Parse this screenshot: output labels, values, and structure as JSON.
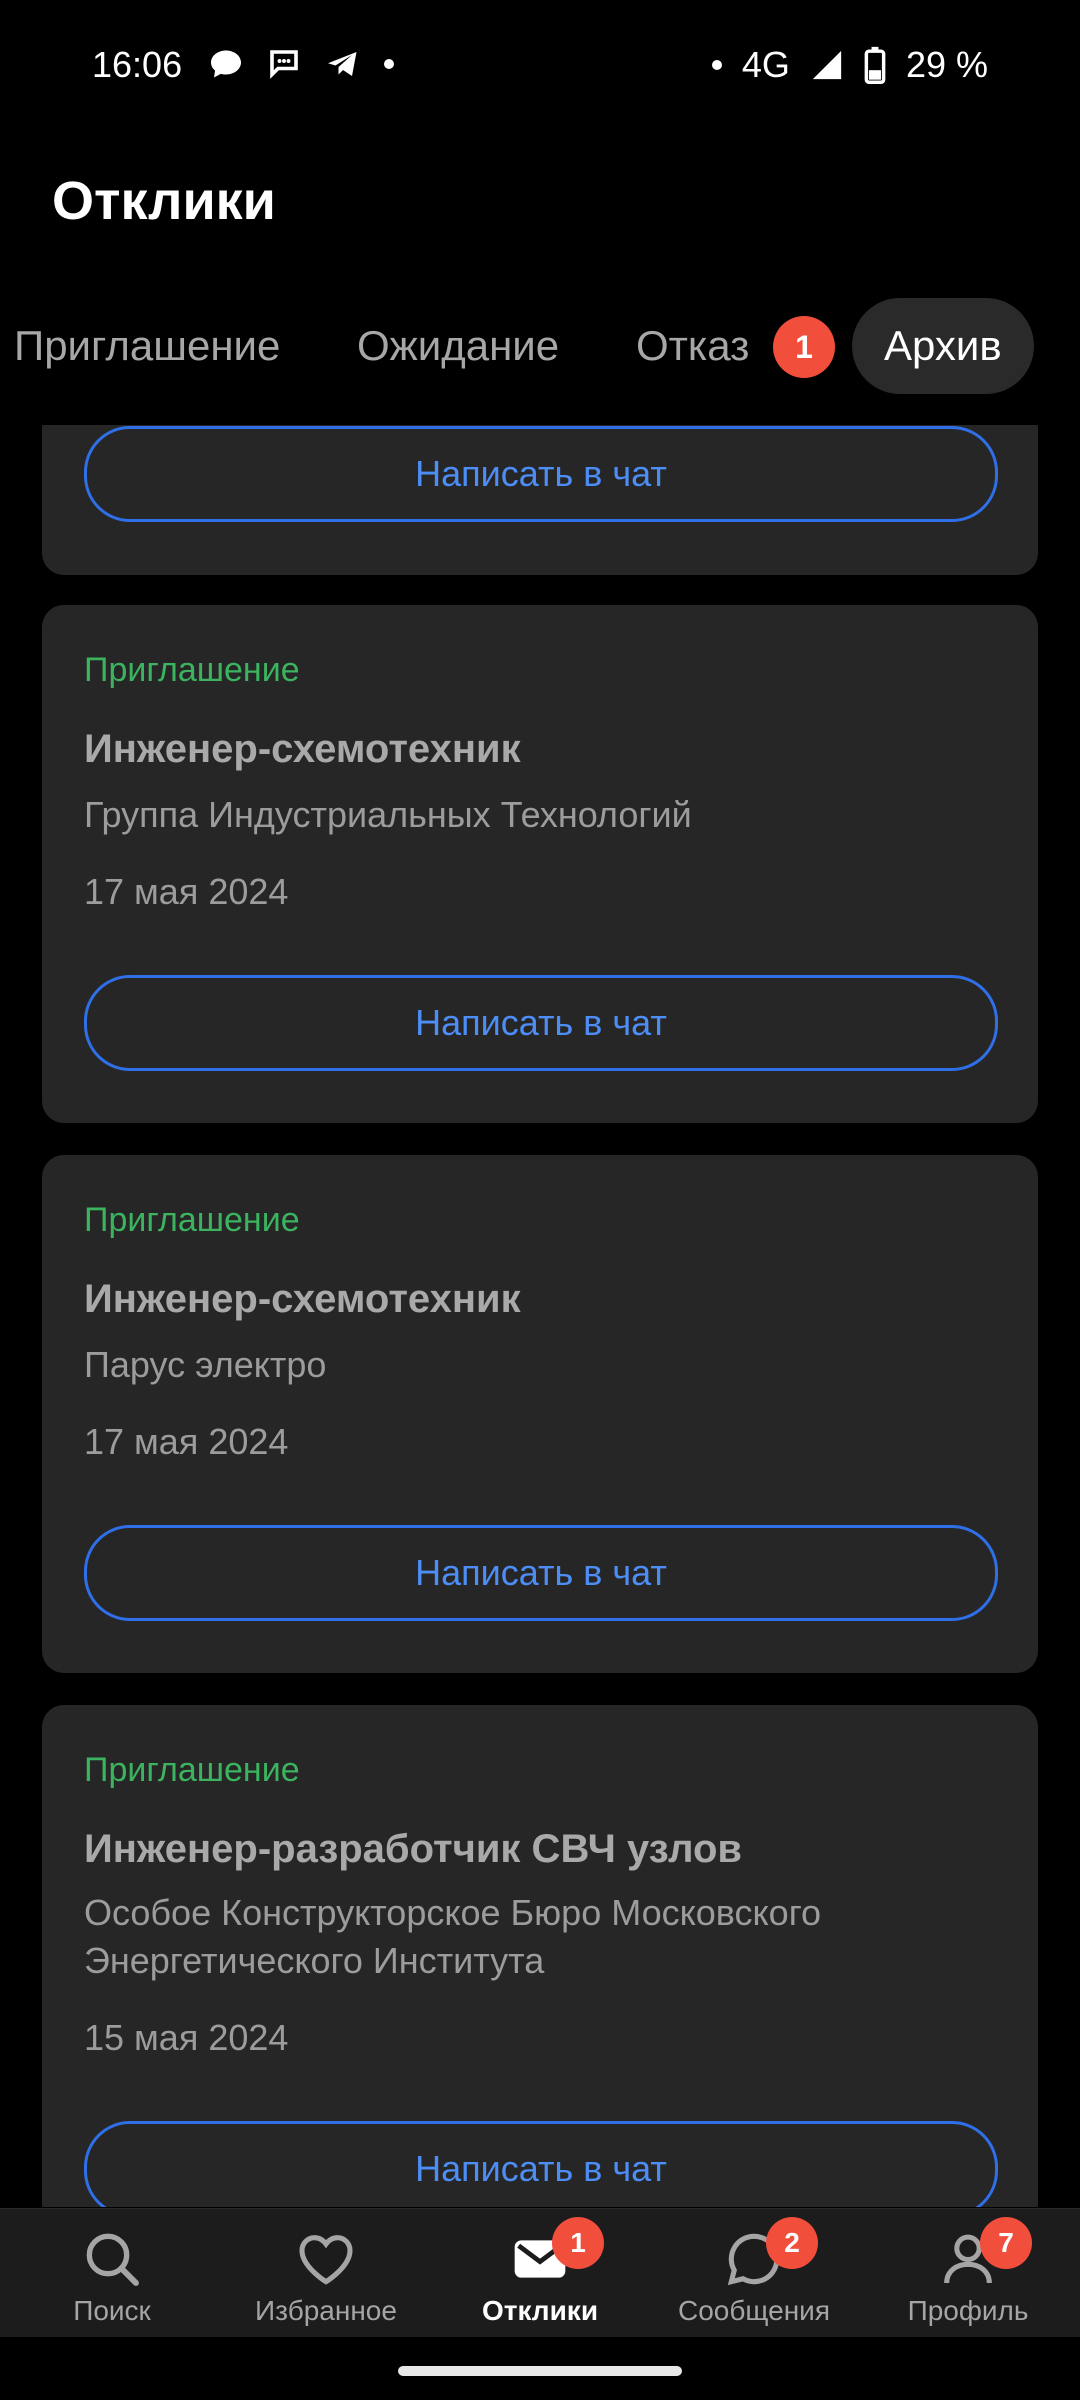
{
  "status_bar": {
    "time": "16:06",
    "network": "4G",
    "battery": "29 %"
  },
  "header": {
    "title": "Отклики"
  },
  "tabs": [
    {
      "label": "Приглашение"
    },
    {
      "label": "Ожидание"
    },
    {
      "label": "Отказ",
      "badge": "1"
    },
    {
      "label": "Архив",
      "active": true
    }
  ],
  "cards": [
    {
      "button": "Написать в чат"
    },
    {
      "status": "Приглашение",
      "title": "Инженер-схемотехник",
      "company": "Группа Индустриальных Технологий",
      "date": "17 мая 2024",
      "button": "Написать в чат"
    },
    {
      "status": "Приглашение",
      "title": "Инженер-схемотехник",
      "company": "Парус электро",
      "date": "17 мая 2024",
      "button": "Написать в чат"
    },
    {
      "status": "Приглашение",
      "title": "Инженер-разработчик СВЧ узлов",
      "company": "Особое Конструкторское Бюро Московского Энергетического Института",
      "date": "15 мая 2024",
      "button": "Написать в чат"
    }
  ],
  "bottom_nav": [
    {
      "label": "Поиск",
      "icon": "search-icon"
    },
    {
      "label": "Избранное",
      "icon": "heart-icon"
    },
    {
      "label": "Отклики",
      "icon": "envelope-icon",
      "badge": "1",
      "active": true
    },
    {
      "label": "Сообщения",
      "icon": "chat-bubble-icon",
      "badge": "2"
    },
    {
      "label": "Профиль",
      "icon": "profile-icon",
      "badge": "7"
    }
  ],
  "colors": {
    "accent_blue": "#2f6fe8",
    "status_green": "#3bb35f",
    "badge_red": "#f24e3c",
    "card_bg": "#262626"
  }
}
